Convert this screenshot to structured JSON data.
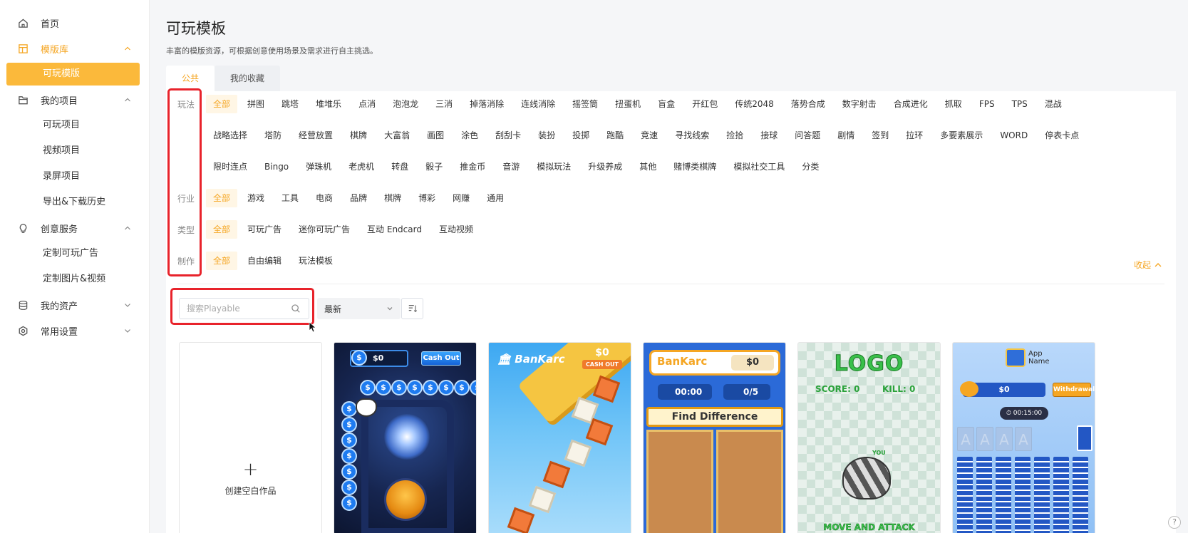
{
  "sidebar": {
    "items": [
      {
        "type": "item",
        "label": "首页",
        "icon": "home-icon"
      },
      {
        "type": "group",
        "label": "模版库",
        "icon": "template-icon",
        "expanded": true,
        "active": true
      },
      {
        "type": "sub",
        "label": "可玩模版",
        "selected": true
      },
      {
        "type": "group",
        "label": "我的项目",
        "icon": "folder-icon",
        "expanded": true
      },
      {
        "type": "sub",
        "label": "可玩项目"
      },
      {
        "type": "sub",
        "label": "视频项目"
      },
      {
        "type": "sub",
        "label": "录屏项目"
      },
      {
        "type": "sub",
        "label": "导出&下载历史"
      },
      {
        "type": "group",
        "label": "创意服务",
        "icon": "bulb-icon",
        "expanded": true
      },
      {
        "type": "sub",
        "label": "定制可玩广告"
      },
      {
        "type": "sub",
        "label": "定制图片&视频"
      },
      {
        "type": "group",
        "label": "我的资产",
        "icon": "database-icon",
        "expanded": false
      },
      {
        "type": "group",
        "label": "常用设置",
        "icon": "settings-icon",
        "expanded": false
      }
    ]
  },
  "page": {
    "title": "可玩模板",
    "description": "丰富的模版资源，可根据创意使用场景及需求进行自主挑选。"
  },
  "tabs": [
    {
      "label": "公共",
      "active": true
    },
    {
      "label": "我的收藏",
      "active": false
    }
  ],
  "filters": {
    "gameplay": {
      "label": "玩法",
      "rows": [
        [
          "全部",
          "拼图",
          "跳塔",
          "堆堆乐",
          "点消",
          "泡泡龙",
          "三消",
          "掉落消除",
          "连线消除",
          "摇签筒",
          "扭蛋机",
          "盲盒",
          "开红包",
          "传统2048",
          "落势合成",
          "数字射击",
          "合成进化",
          "抓取",
          "FPS",
          "TPS",
          "混战"
        ],
        [
          "战略选择",
          "塔防",
          "经营放置",
          "棋牌",
          "大富翁",
          "画图",
          "涂色",
          "刮刮卡",
          "装扮",
          "投掷",
          "跑酷",
          "竞速",
          "寻找线索",
          "捡拾",
          "接球",
          "问答题",
          "剧情",
          "签到",
          "拉环",
          "多要素展示",
          "WORD",
          "停表卡点"
        ],
        [
          "限时连点",
          "Bingo",
          "弹珠机",
          "老虎机",
          "转盘",
          "骰子",
          "推金币",
          "音游",
          "模拟玩法",
          "升级养成",
          "其他",
          "赌博类棋牌",
          "模拟社交工具",
          "分类"
        ]
      ]
    },
    "industry": {
      "label": "行业",
      "options": [
        "全部",
        "游戏",
        "工具",
        "电商",
        "品牌",
        "棋牌",
        "博彩",
        "网赚",
        "通用"
      ]
    },
    "type": {
      "label": "类型",
      "options": [
        "全部",
        "可玩广告",
        "迷你可玩广告",
        "互动 Endcard",
        "互动视频"
      ]
    },
    "production": {
      "label": "制作",
      "options": [
        "全部",
        "自由编辑",
        "玩法模板"
      ]
    },
    "collapse_label": "收起"
  },
  "toolbar": {
    "search_placeholder": "搜索Playable",
    "sort_value": "最新"
  },
  "cards": {
    "blank_label": "创建空白作品",
    "card1": {
      "balance": "$0",
      "cashout": "Cash Out",
      "coin": "$"
    },
    "card2": {
      "brand": "BanKarc",
      "balance": "$0",
      "cashout": "CASH OUT"
    },
    "card3": {
      "brand": "BanKarc",
      "balance": "$0",
      "timer": "00:00",
      "progress": "0/5",
      "banner": "Find Difference"
    },
    "card4": {
      "logo": "LOGO",
      "score": "SCORE:  0",
      "kill": "KILL:  0",
      "you": "YOU",
      "cta": "MOVE AND ATTACK"
    },
    "card5": {
      "app_name": "App\nName",
      "balance": "$0",
      "withdraw": "Withdrawal",
      "timer": "00:15:00",
      "slot_letter": "A"
    }
  },
  "help_label": "?",
  "colors": {
    "accent": "#f5a623",
    "selected_bg": "#fbb93b",
    "annotation_red": "#e8232b"
  }
}
